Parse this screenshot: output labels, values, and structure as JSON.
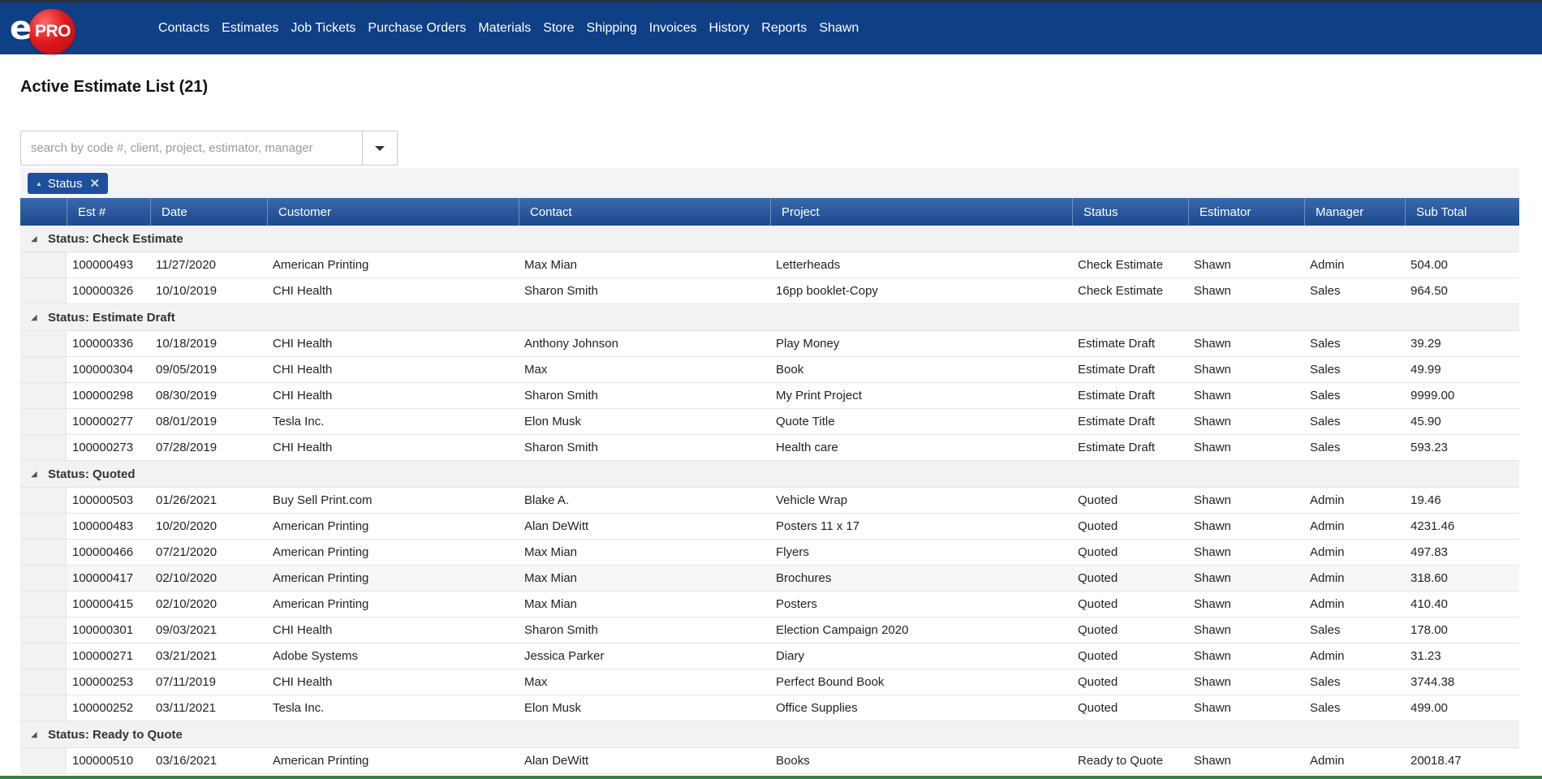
{
  "app": {
    "logo_e": "e",
    "logo_pro": "PRO"
  },
  "nav": [
    "Contacts",
    "Estimates",
    "Job Tickets",
    "Purchase Orders",
    "Materials",
    "Store",
    "Shipping",
    "Invoices",
    "History",
    "Reports",
    "Shawn"
  ],
  "page": {
    "title": "Active Estimate List (21)"
  },
  "search": {
    "placeholder": "search by code #, client, project, estimator, manager",
    "value": ""
  },
  "grouping": {
    "chip_label": "Status"
  },
  "columns": [
    "Est #",
    "Date",
    "Customer",
    "Contact",
    "Project",
    "Status",
    "Estimator",
    "Manager",
    "Sub Total"
  ],
  "groups": [
    {
      "label": "Status: Check Estimate",
      "rows": [
        [
          "100000493",
          "11/27/2020",
          "American Printing",
          "Max Mian",
          "Letterheads",
          "Check Estimate",
          "Shawn",
          "Admin",
          "504.00"
        ],
        [
          "100000326",
          "10/10/2019",
          "CHI Health",
          "Sharon Smith",
          "16pp booklet-Copy",
          "Check Estimate",
          "Shawn",
          "Sales",
          "964.50"
        ]
      ]
    },
    {
      "label": "Status: Estimate Draft",
      "rows": [
        [
          "100000336",
          "10/18/2019",
          "CHI Health",
          "Anthony Johnson",
          "Play Money",
          "Estimate Draft",
          "Shawn",
          "Sales",
          "39.29"
        ],
        [
          "100000304",
          "09/05/2019",
          "CHI Health",
          "Max",
          "Book",
          "Estimate Draft",
          "Shawn",
          "Sales",
          "49.99"
        ],
        [
          "100000298",
          "08/30/2019",
          "CHI Health",
          "Sharon Smith",
          "My Print Project",
          "Estimate Draft",
          "Shawn",
          "Sales",
          "9999.00"
        ],
        [
          "100000277",
          "08/01/2019",
          "Tesla Inc.",
          "Elon Musk",
          "Quote Title",
          "Estimate Draft",
          "Shawn",
          "Sales",
          "45.90"
        ],
        [
          "100000273",
          "07/28/2019",
          "CHI Health",
          "Sharon Smith",
          "Health care",
          "Estimate Draft",
          "Shawn",
          "Sales",
          "593.23"
        ]
      ]
    },
    {
      "label": "Status: Quoted",
      "rows": [
        [
          "100000503",
          "01/26/2021",
          "Buy Sell Print.com",
          "Blake A.",
          "Vehicle Wrap",
          "Quoted",
          "Shawn",
          "Admin",
          "19.46"
        ],
        [
          "100000483",
          "10/20/2020",
          "American Printing",
          "Alan DeWitt",
          "Posters 11 x 17",
          "Quoted",
          "Shawn",
          "Admin",
          "4231.46"
        ],
        [
          "100000466",
          "07/21/2020",
          "American Printing",
          "Max Mian",
          "Flyers",
          "Quoted",
          "Shawn",
          "Admin",
          "497.83"
        ],
        [
          "100000417",
          "02/10/2020",
          "American Printing",
          "Max Mian",
          "Brochures",
          "Quoted",
          "Shawn",
          "Admin",
          "318.60"
        ],
        [
          "100000415",
          "02/10/2020",
          "American Printing",
          "Max Mian",
          "Posters",
          "Quoted",
          "Shawn",
          "Admin",
          "410.40"
        ],
        [
          "100000301",
          "09/03/2021",
          "CHI Health",
          "Sharon Smith",
          "Election Campaign 2020",
          "Quoted",
          "Shawn",
          "Sales",
          "178.00"
        ],
        [
          "100000271",
          "03/21/2021",
          "Adobe Systems",
          "Jessica Parker",
          "Diary",
          "Quoted",
          "Shawn",
          "Admin",
          "31.23"
        ],
        [
          "100000253",
          "07/11/2019",
          "CHI Health",
          "Max",
          "Perfect Bound Book",
          "Quoted",
          "Shawn",
          "Sales",
          "3744.38"
        ],
        [
          "100000252",
          "03/11/2021",
          "Tesla Inc.",
          "Elon Musk",
          "Office Supplies",
          "Quoted",
          "Shawn",
          "Sales",
          "499.00"
        ]
      ]
    },
    {
      "label": "Status: Ready to Quote",
      "rows": [
        [
          "100000510",
          "03/16/2021",
          "American Printing",
          "Alan DeWitt",
          "Books",
          "Ready to Quote",
          "Shawn",
          "Admin",
          "20018.47"
        ]
      ]
    }
  ]
}
